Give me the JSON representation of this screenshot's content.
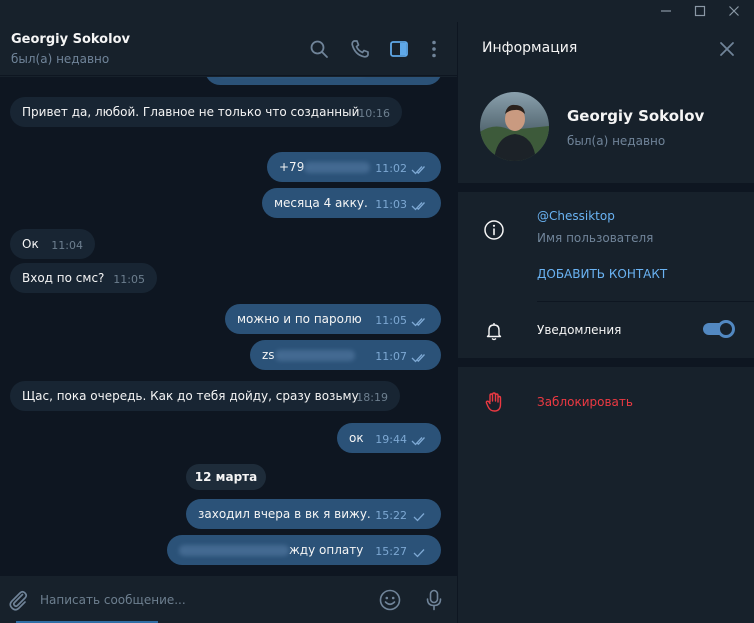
{
  "chat": {
    "peer_name": "Georgiy Sokolov",
    "peer_status": "был(а) недавно",
    "date_separator": "12 марта",
    "messages": [
      {
        "dir": "in",
        "text": "Привет да, любой. Главное не только что созданный",
        "time": "10:16"
      },
      {
        "dir": "out",
        "text": "+79",
        "time": "11:02",
        "redacted": true,
        "read": true
      },
      {
        "dir": "out",
        "text": "месяца 4 акку.",
        "time": "11:03",
        "read": true
      },
      {
        "dir": "in",
        "text": "Ок",
        "time": "11:04"
      },
      {
        "dir": "in",
        "text": "Вход по смс?",
        "time": "11:05"
      },
      {
        "dir": "out",
        "text": "можно и по паролю",
        "time": "11:05",
        "read": true
      },
      {
        "dir": "out",
        "text": "zs",
        "time": "11:07",
        "redacted": true,
        "read": true
      },
      {
        "dir": "in",
        "text": "Щас, пока очередь. Как до тебя дойду, сразу возьму",
        "time": "18:19"
      },
      {
        "dir": "out",
        "text": "ок",
        "time": "19:44",
        "read": true
      },
      {
        "dir": "out",
        "text": "заходил вчера в вк я вижу.",
        "time": "15:22",
        "read": false
      },
      {
        "dir": "out",
        "text": "жду оплату",
        "time": "15:27",
        "redacted": true,
        "read": false
      }
    ]
  },
  "composer": {
    "placeholder": "Написать сообщение..."
  },
  "info_panel": {
    "title": "Информация",
    "name": "Georgiy Sokolov",
    "status": "был(а) недавно",
    "username": "@Chessiktop",
    "username_label": "Имя пользователя",
    "add_contact": "ДОБАВИТЬ КОНТАКТ",
    "notifications_label": "Уведомления",
    "notifications_on": true,
    "block_label": "Заблокировать"
  },
  "icons": {
    "header": [
      "search-icon",
      "phone-icon",
      "sidebar-toggle-icon",
      "more-vertical-icon"
    ],
    "composer": [
      "attach-icon",
      "emoji-icon",
      "microphone-icon"
    ],
    "info": [
      "close-icon",
      "info-icon",
      "bell-icon",
      "hand-block-icon"
    ]
  },
  "colors": {
    "accent": "#5288c1",
    "link": "#6ab3f3",
    "danger": "#ec3942",
    "bubble_out": "#2b5278",
    "bubble_in": "#182533"
  }
}
